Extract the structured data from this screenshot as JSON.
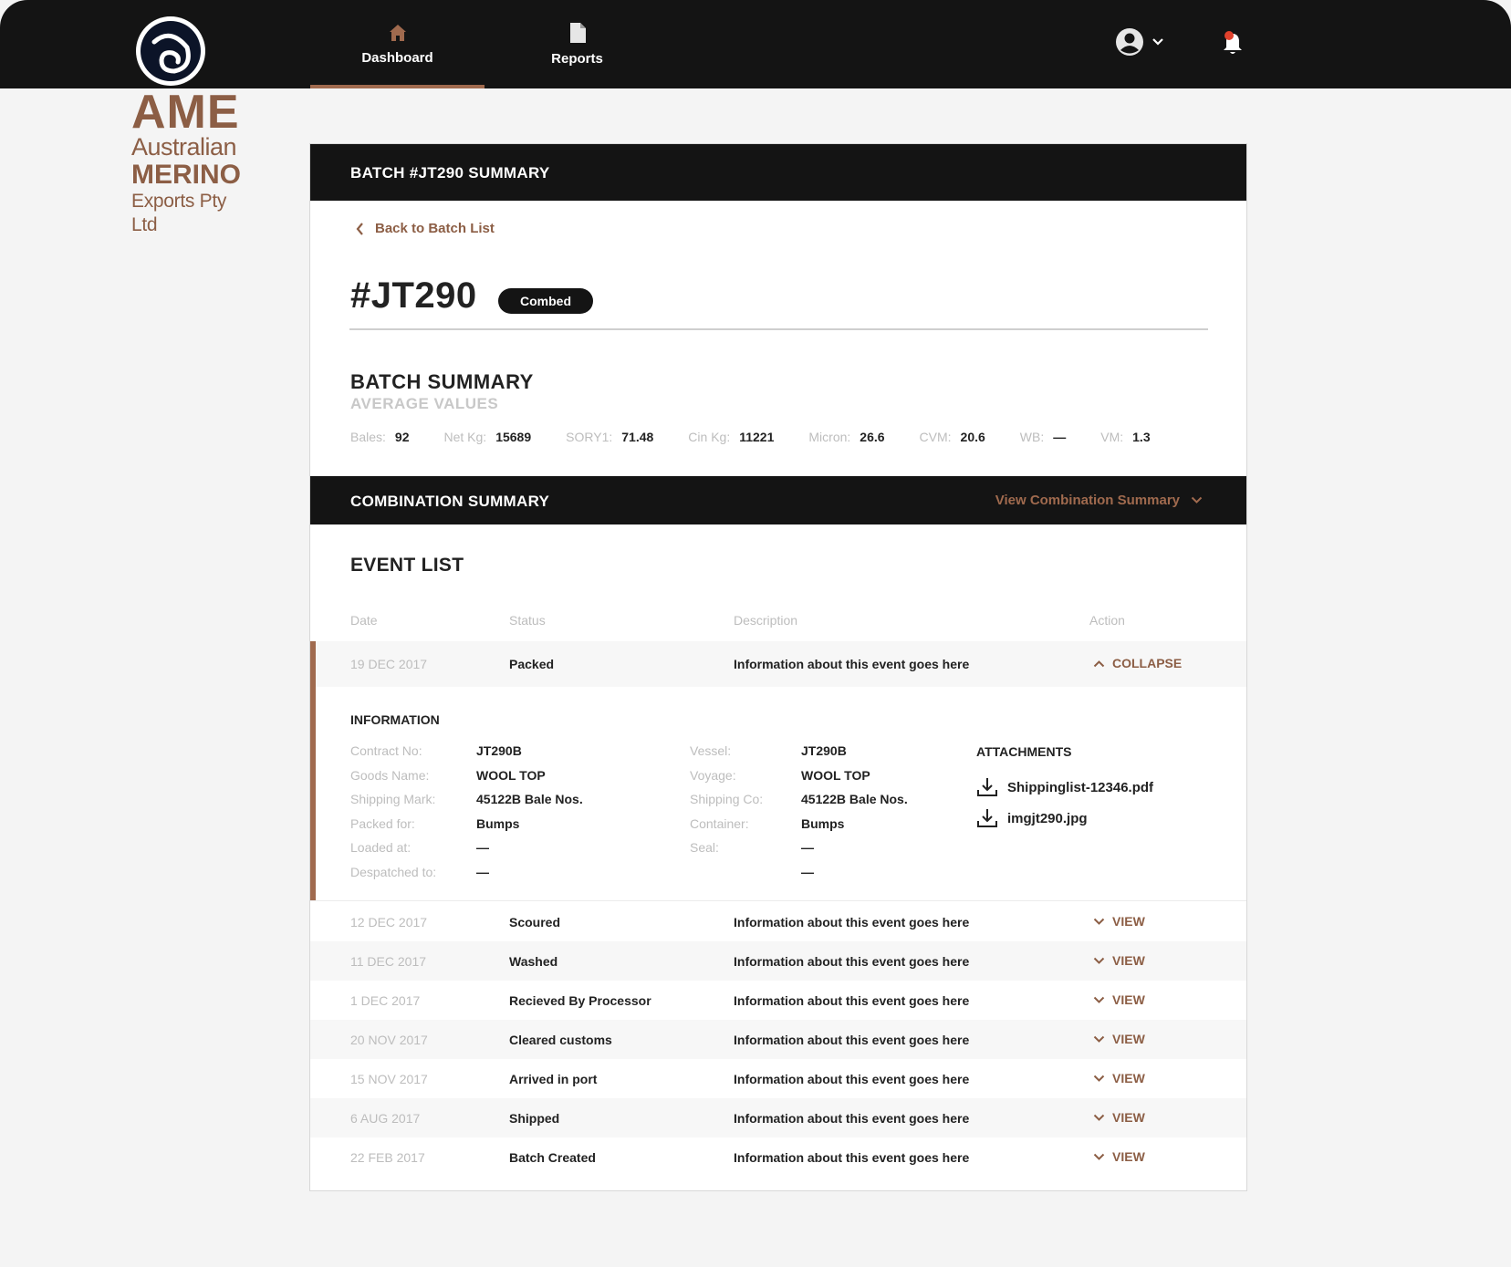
{
  "nav": {
    "dashboard": "Dashboard",
    "reports": "Reports"
  },
  "logo": {
    "ame": "AME",
    "australian": "Australian",
    "merino": "MERINO",
    "exports": "Exports Pty Ltd"
  },
  "card": {
    "header": "BATCH #JT290 SUMMARY",
    "back": "Back to Batch List",
    "batch_id": "#JT290",
    "badge": "Combed",
    "summary_title": "BATCH SUMMARY",
    "summary_sub": "AVERAGE VALUES"
  },
  "stats": [
    {
      "k": "Bales:",
      "v": "92"
    },
    {
      "k": "Net Kg:",
      "v": "15689"
    },
    {
      "k": "SORY1:",
      "v": "71.48"
    },
    {
      "k": "Cin Kg:",
      "v": "11221"
    },
    {
      "k": "Micron:",
      "v": "26.6"
    },
    {
      "k": "CVM:",
      "v": "20.6"
    },
    {
      "k": "WB:",
      "v": "—"
    },
    {
      "k": "VM:",
      "v": "1.3"
    }
  ],
  "combination": {
    "title": "COMBINATION SUMMARY",
    "view": "View Combination Summary"
  },
  "events": {
    "title": "EVENT LIST",
    "headers": {
      "date": "Date",
      "status": "Status",
      "description": "Description",
      "action": "Action"
    },
    "expanded": {
      "date": "19 DEC 2017",
      "status": "Packed",
      "desc": "Information about this event goes here",
      "action": "COLLAPSE"
    },
    "info": {
      "title": "INFORMATION",
      "left": [
        {
          "k": "Contract No:",
          "v": "JT290B"
        },
        {
          "k": "Goods Name:",
          "v": "WOOL TOP"
        },
        {
          "k": "Shipping Mark:",
          "v": "45122B Bale Nos."
        },
        {
          "k": "Packed for:",
          "v": "Bumps"
        },
        {
          "k": "Loaded at:",
          "v": "—"
        },
        {
          "k": "Despatched to:",
          "v": "—"
        }
      ],
      "right": [
        {
          "k": "Vessel:",
          "v": "JT290B"
        },
        {
          "k": "Voyage:",
          "v": "WOOL TOP"
        },
        {
          "k": "Shipping Co:",
          "v": "45122B Bale Nos."
        },
        {
          "k": "Container:",
          "v": "Bumps"
        },
        {
          "k": "Seal:",
          "v": "—"
        },
        {
          "k": "",
          "v": "—"
        }
      ],
      "attachments_title": "ATTACHMENTS",
      "attachments": [
        "Shippinglist-12346.pdf",
        "imgjt290.jpg"
      ]
    },
    "rows": [
      {
        "date": "12 DEC 2017",
        "status": "Scoured",
        "desc": "Information about this event goes here",
        "action": "VIEW"
      },
      {
        "date": "11 DEC 2017",
        "status": "Washed",
        "desc": "Information about this event goes here",
        "action": "VIEW"
      },
      {
        "date": "1 DEC 2017",
        "status": "Recieved By Processor",
        "desc": "Information about this event goes here",
        "action": "VIEW"
      },
      {
        "date": "20 NOV 2017",
        "status": "Cleared customs",
        "desc": "Information about this event goes here",
        "action": "VIEW"
      },
      {
        "date": "15 NOV 2017",
        "status": "Arrived in port",
        "desc": "Information about this event goes here",
        "action": "VIEW"
      },
      {
        "date": "6 AUG 2017",
        "status": "Shipped",
        "desc": "Information about this event goes here",
        "action": "VIEW"
      },
      {
        "date": "22 FEB 2017",
        "status": "Batch Created",
        "desc": "Information about this event goes here",
        "action": "VIEW"
      }
    ]
  },
  "colors": {
    "brand": "#8c5e45",
    "accent": "#a06a4e",
    "dark": "#141414",
    "notification": "#e0412c"
  }
}
